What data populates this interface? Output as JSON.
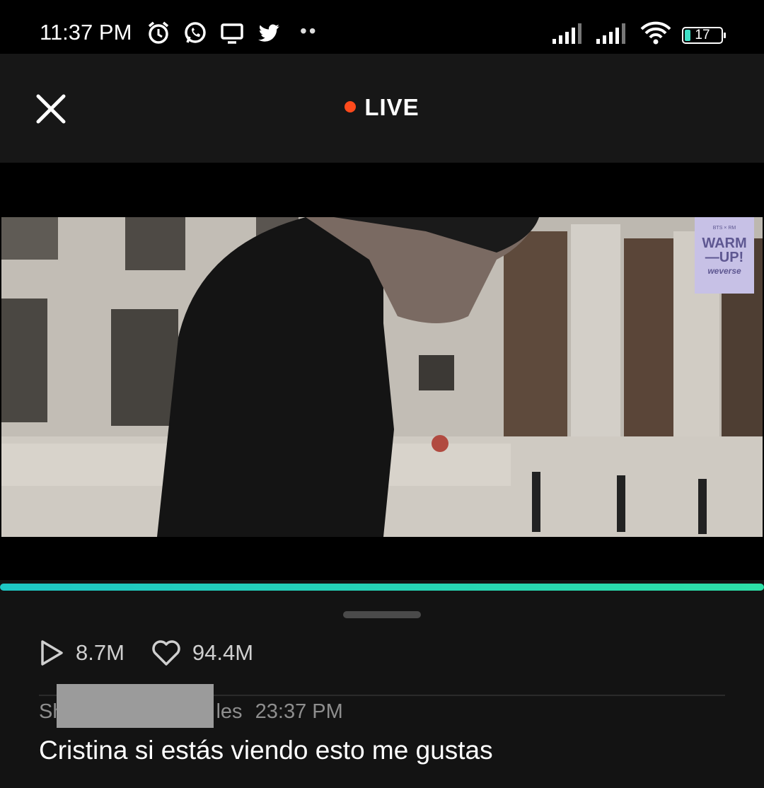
{
  "status_bar": {
    "time": "11:37 PM",
    "icons": [
      "alarm-icon",
      "whatsapp-icon",
      "cast-icon",
      "twitter-icon"
    ],
    "overflow": "••",
    "battery_level": "17"
  },
  "header": {
    "live_label": "LIVE",
    "live_dot_color": "#ff4a1c"
  },
  "video": {
    "badge": {
      "line1": "BTS × RM",
      "line2": "WARM",
      "line3": "—UP!",
      "line4": "weverse"
    }
  },
  "progress": {
    "value": 1.0,
    "color": "#1ec7c5"
  },
  "stats": {
    "plays": "8.7M",
    "likes": "94.4M"
  },
  "comment": {
    "author_start": "Sh",
    "author_end": "les",
    "time": "23:37 PM",
    "text": "Cristina si estás viendo esto me gustas"
  }
}
